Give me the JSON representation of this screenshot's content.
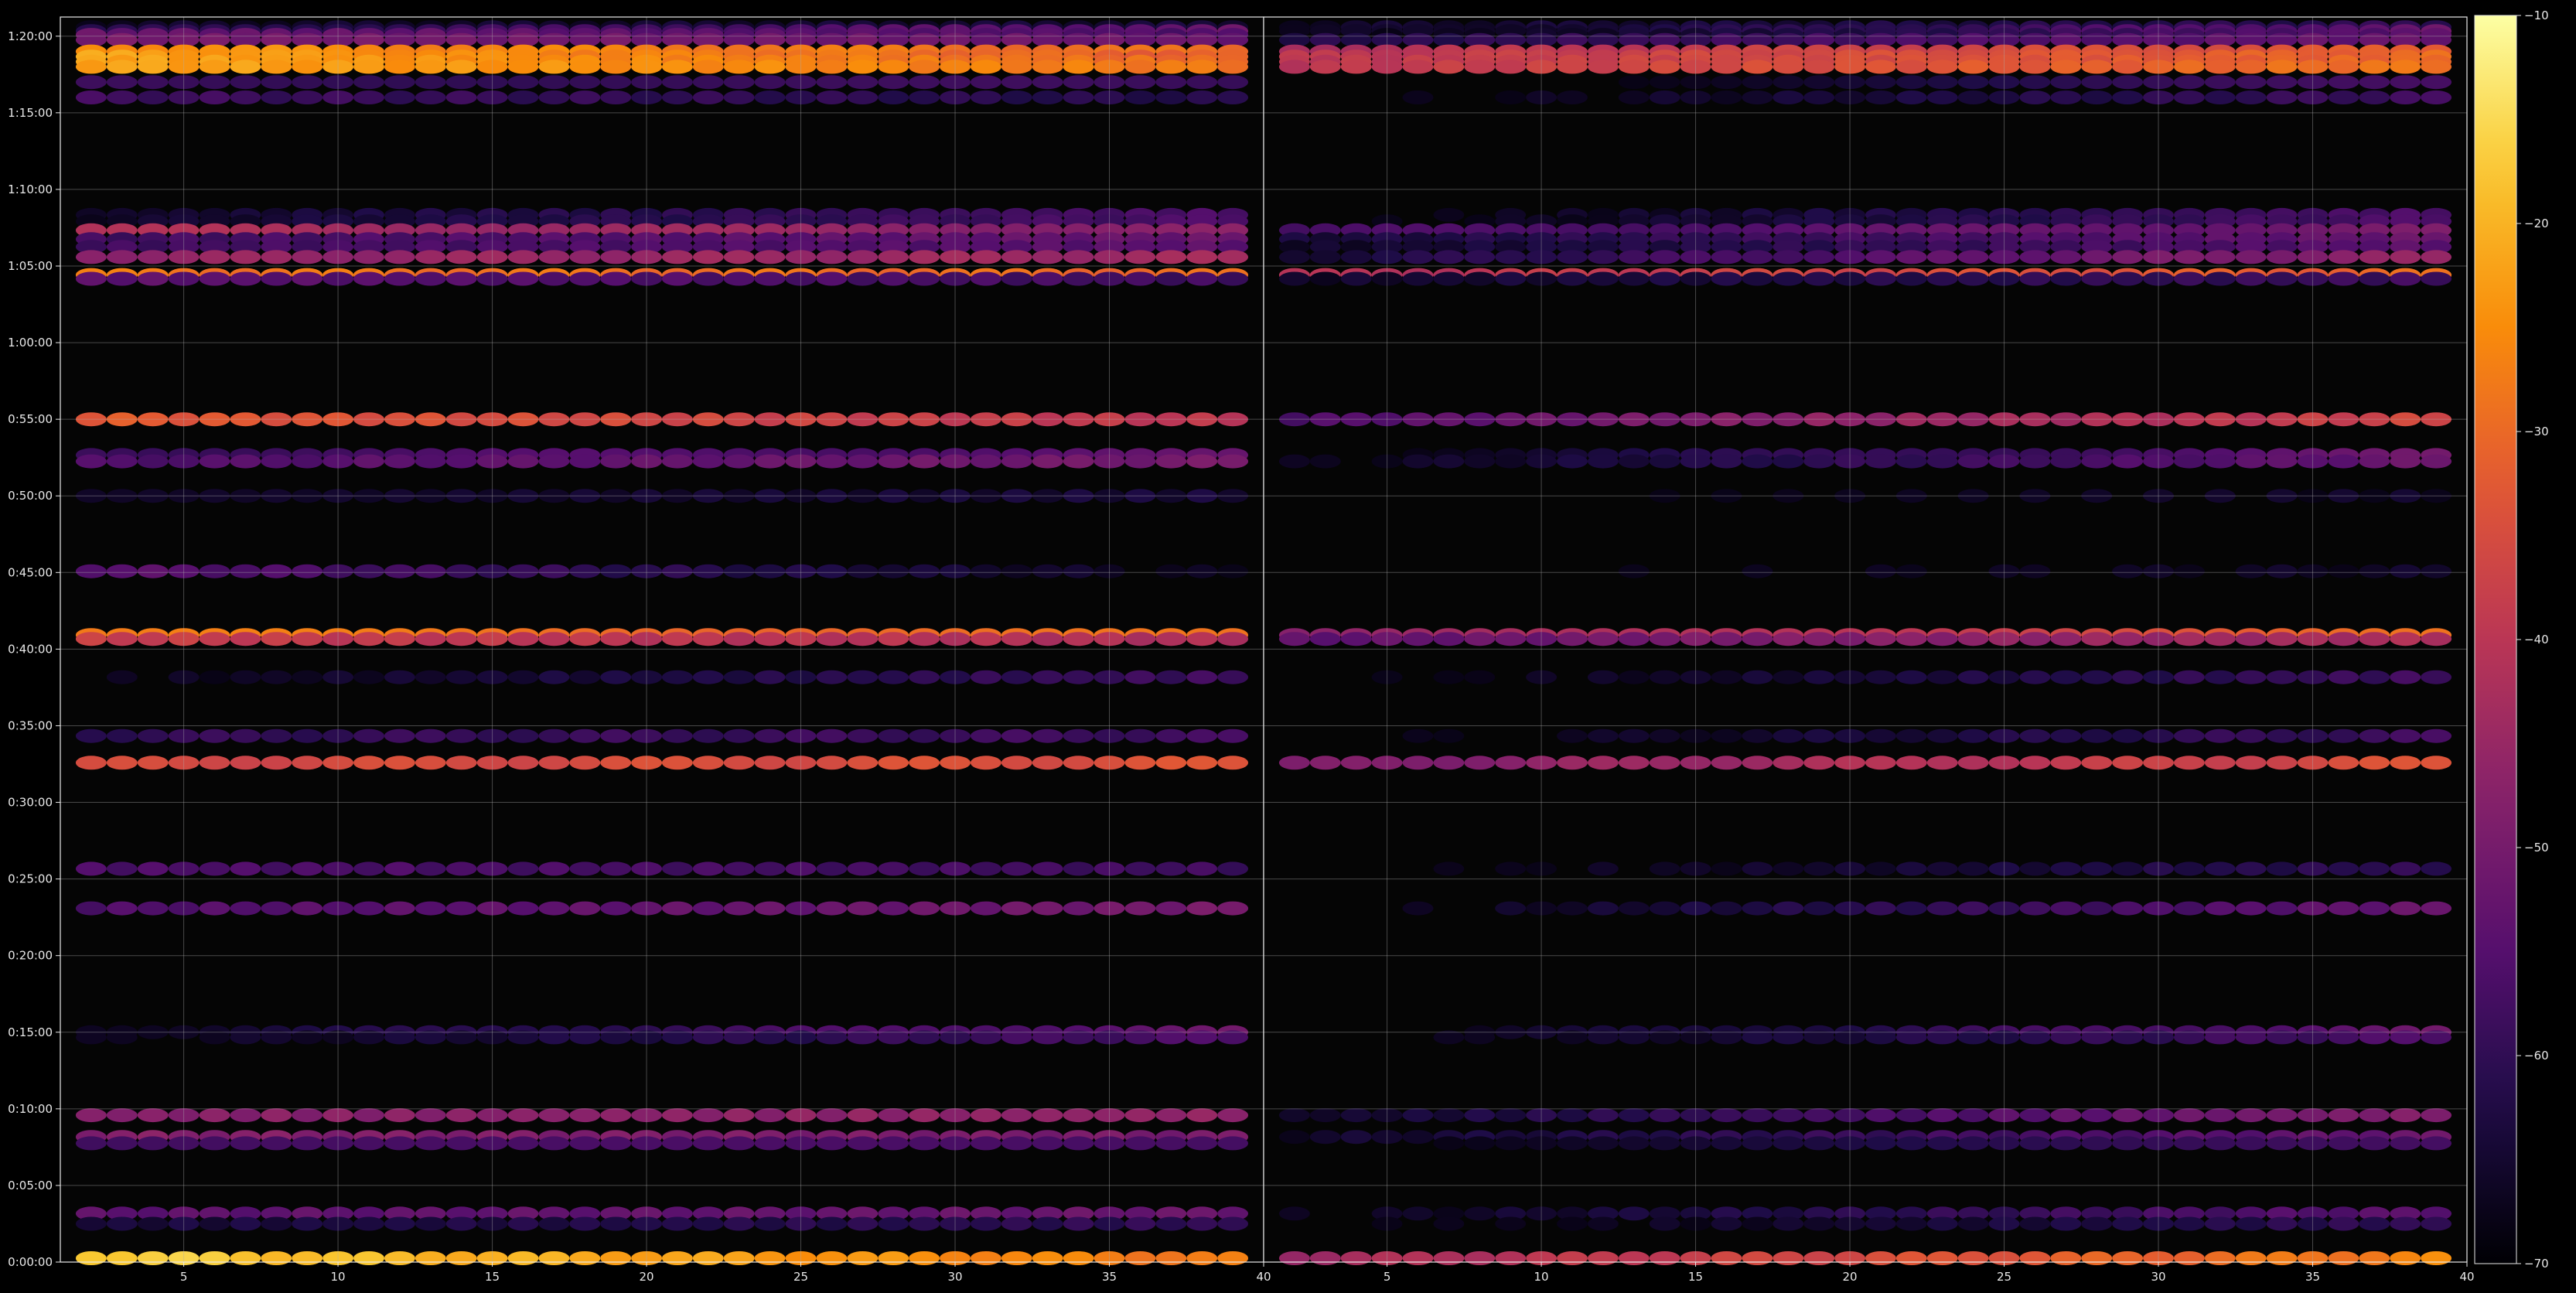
{
  "chart_data": {
    "type": "heatmap",
    "title": "",
    "xlabel": "",
    "ylabel": "",
    "background": "#000000",
    "plot_background": "#050505",
    "grid": true,
    "colormap": "inferno",
    "clim": [
      -70,
      -10
    ],
    "colorbar": {
      "position": "right",
      "ticks": [
        -10,
        -20,
        -30,
        -40,
        -50,
        -60,
        -70
      ]
    },
    "panels": [
      {
        "name": "",
        "xlim": [
          1,
          40
        ],
        "x_ticks": [
          5,
          10,
          15,
          20,
          25,
          30,
          35,
          40
        ],
        "columns_x": [
          2,
          39
        ]
      },
      {
        "name": "",
        "xlim": [
          40,
          79
        ],
        "x_ticks": [
          5,
          10,
          15,
          20,
          25,
          30,
          35,
          40
        ],
        "columns_x": [
          41,
          78
        ]
      }
    ],
    "y_axis": {
      "unit": "seconds",
      "ylim": [
        0,
        4875
      ],
      "ticks": [
        "0:00:00",
        "0:05:00",
        "0:10:00",
        "0:15:00",
        "0:20:00",
        "0:25:00",
        "0:30:00",
        "0:35:00",
        "0:40:00",
        "0:45:00",
        "0:50:00",
        "0:55:00",
        "1:00:00",
        "1:05:00",
        "1:10:00",
        "1:15:00",
        "1:20:00"
      ],
      "tick_values": [
        0,
        300,
        600,
        900,
        1200,
        1500,
        1800,
        2100,
        2400,
        2700,
        3000,
        3300,
        3600,
        3900,
        4200,
        4500,
        4800
      ]
    },
    "rows": [
      {
        "t": 4835,
        "left": [
          -66,
          -64
        ],
        "right": [
          -66,
          -60
        ]
      },
      {
        "t": 4820,
        "left": [
          -62,
          -52
        ],
        "right": [
          -68,
          -52
        ]
      },
      {
        "t": 4805,
        "left": [
          -52,
          -56
        ],
        "right": [
          -70,
          -54
        ]
      },
      {
        "t": 4785,
        "left": [
          -50,
          -52
        ],
        "right": [
          -62,
          -52
        ]
      },
      {
        "t": 4740,
        "left": [
          -24,
          -30
        ],
        "right": [
          -42,
          -32
        ]
      },
      {
        "t": 4720,
        "left": [
          -22,
          -32
        ],
        "right": [
          -40,
          -30
        ]
      },
      {
        "t": 4700,
        "left": [
          -22,
          -30
        ],
        "right": [
          -40,
          -30
        ]
      },
      {
        "t": 4680,
        "left": [
          -22,
          -28
        ],
        "right": [
          -40,
          -28
        ]
      },
      {
        "t": 4620,
        "left": [
          -58,
          -60
        ],
        "right": [
          -70,
          -58
        ]
      },
      {
        "t": 4560,
        "left": [
          -58,
          -62
        ],
        "right": [
          -70,
          -58
        ]
      },
      {
        "t": 4100,
        "left": [
          -66,
          -56
        ],
        "right": [
          -70,
          -56
        ]
      },
      {
        "t": 4075,
        "left": [
          -66,
          -56
        ],
        "right": [
          -70,
          -56
        ]
      },
      {
        "t": 4040,
        "left": [
          -42,
          -48
        ],
        "right": [
          -58,
          -50
        ]
      },
      {
        "t": 4005,
        "left": [
          -58,
          -52
        ],
        "right": [
          -64,
          -52
        ]
      },
      {
        "t": 3975,
        "left": [
          -58,
          -54
        ],
        "right": [
          -66,
          -54
        ]
      },
      {
        "t": 3935,
        "left": [
          -46,
          -44
        ],
        "right": [
          -64,
          -46
        ]
      },
      {
        "t": 3865,
        "left": [
          -28,
          -30
        ],
        "right": [
          -42,
          -30
        ]
      },
      {
        "t": 3850,
        "left": [
          -54,
          -58
        ],
        "right": [
          -66,
          -58
        ]
      },
      {
        "t": 3300,
        "left": [
          -32,
          -40
        ],
        "right": [
          -56,
          -36
        ]
      },
      {
        "t": 3160,
        "left": [
          -58,
          -54
        ],
        "right": [
          -68,
          -52
        ]
      },
      {
        "t": 3135,
        "left": [
          -56,
          -50
        ],
        "right": [
          -68,
          -52
        ]
      },
      {
        "t": 3000,
        "left": [
          -66,
          -64
        ],
        "right": [
          -70,
          -66
        ]
      },
      {
        "t": 2705,
        "left": [
          -54,
          -68
        ],
        "right": [
          -70,
          -66
        ]
      },
      {
        "t": 2455,
        "left": [
          -28,
          -30
        ],
        "right": [
          -48,
          -30
        ]
      },
      {
        "t": 2440,
        "left": [
          -38,
          -42
        ],
        "right": [
          -54,
          -42
        ]
      },
      {
        "t": 2290,
        "left": [
          -68,
          -58
        ],
        "right": [
          -70,
          -58
        ]
      },
      {
        "t": 2060,
        "left": [
          -60,
          -58
        ],
        "right": [
          -70,
          -58
        ]
      },
      {
        "t": 1955,
        "left": [
          -36,
          -34
        ],
        "right": [
          -50,
          -34
        ]
      },
      {
        "t": 1540,
        "left": [
          -56,
          -58
        ],
        "right": [
          -70,
          -60
        ]
      },
      {
        "t": 1385,
        "left": [
          -56,
          -50
        ],
        "right": [
          -70,
          -52
        ]
      },
      {
        "t": 900,
        "left": [
          -66,
          -52
        ],
        "right": [
          -70,
          -52
        ]
      },
      {
        "t": 880,
        "left": [
          -68,
          -56
        ],
        "right": [
          -70,
          -56
        ]
      },
      {
        "t": 575,
        "left": [
          -48,
          -46
        ],
        "right": [
          -66,
          -48
        ]
      },
      {
        "t": 490,
        "left": [
          -48,
          -50
        ],
        "right": [
          -66,
          -52
        ]
      },
      {
        "t": 465,
        "left": [
          -58,
          -58
        ],
        "right": [
          -70,
          -58
        ]
      },
      {
        "t": 190,
        "left": [
          -54,
          -52
        ],
        "right": [
          -68,
          -54
        ]
      },
      {
        "t": 150,
        "left": [
          -64,
          -60
        ],
        "right": [
          -70,
          -60
        ]
      },
      {
        "t": 15,
        "left": [
          -16,
          -28
        ],
        "right": [
          -44,
          -26
        ]
      }
    ]
  }
}
